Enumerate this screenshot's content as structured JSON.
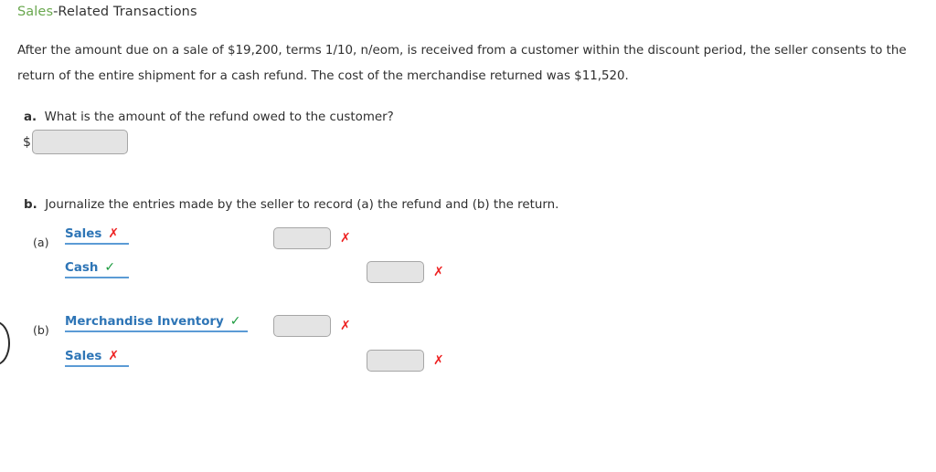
{
  "header": {
    "title_accent": "Sales",
    "title_rest": "-Related Transactions"
  },
  "problem": {
    "text": "After the amount due on a sale of $19,200, terms 1/10, n/eom, is received from a customer within the discount period, the seller consents to the return of the entire shipment for a cash refund. The cost of the merchandise returned was $11,520.",
    "sale_amount": "$19,200",
    "terms": "1/10, n/eom",
    "cost_of_merchandise_returned": "$11,520"
  },
  "question_a": {
    "marker": "a.",
    "text": "What is the amount of the refund owed to the customer?",
    "currency_symbol": "$",
    "answer_value": "",
    "answer_placeholder": ""
  },
  "question_b": {
    "marker": "b.",
    "text": "Journalize the entries made by the seller to record (a) the refund and (b) the return.",
    "entries": [
      {
        "marker": "(a)",
        "lines": [
          {
            "account": "Sales",
            "account_mark": "x",
            "amount_value": "",
            "amount_mark": "x",
            "column": "debit"
          },
          {
            "account": "Cash",
            "account_mark": "check",
            "amount_value": "",
            "amount_mark": "x",
            "column": "credit"
          }
        ]
      },
      {
        "marker": "(b)",
        "lines": [
          {
            "account": "Merchandise Inventory",
            "account_mark": "check",
            "amount_value": "",
            "amount_mark": "x",
            "column": "debit"
          },
          {
            "account": "Sales",
            "account_mark": "x",
            "amount_value": "",
            "amount_mark": "x",
            "column": "credit"
          }
        ]
      }
    ]
  },
  "marks": {
    "incorrect_glyph": "✗",
    "correct_glyph": "✓"
  },
  "colors": {
    "title_accent": "#6aa84f",
    "account_link": "#2e75b6",
    "account_underline": "#5b9bd5",
    "incorrect": "#ee2222",
    "correct": "#1b9b3e",
    "input_fill": "#e4e4e4",
    "input_border": "#a6a6a6"
  }
}
